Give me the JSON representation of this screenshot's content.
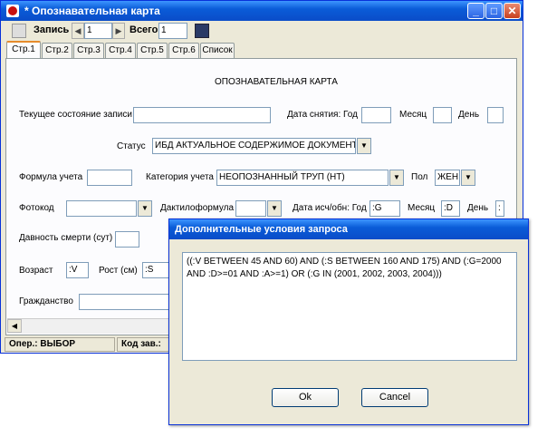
{
  "window": {
    "title": "* Опознавательная карта",
    "minimize_glyph": "_",
    "maximize_glyph": "□",
    "close_glyph": "✕"
  },
  "toolbar": {
    "record_label": "Запись",
    "record_value": "1",
    "total_label": "Всего",
    "total_value": "1",
    "prev_glyph": "◀",
    "next_glyph": "▶"
  },
  "tabs": [
    "Стр.1",
    "Стр.2",
    "Стр.3",
    "Стр.4",
    "Стр.5",
    "Стр.6",
    "Список"
  ],
  "form": {
    "heading": "ОПОЗНАВАТЕЛЬНАЯ КАРТА",
    "record_state_label": "Текущее состояние записи",
    "record_state_value": "",
    "date_year_label": "Дата снятия: Год",
    "date_year_value": "",
    "month_label": "Месяц",
    "month_value": "",
    "day_label": "День",
    "day_value": "",
    "status_label": "Статус",
    "status_value": "ИБД АКТУАЛЬНОЕ СОДЕРЖИМОЕ ДОКУМЕНТА",
    "formula_label": "Формула учета",
    "formula_value": "",
    "category_label": "Категория учета",
    "category_value": "НЕОПОЗНАННЫЙ ТРУП (НТ)",
    "sex_label": "Пол",
    "sex_value": "ЖЕН",
    "photocode_label": "Фотокод",
    "photocode_value": "",
    "dactylo_label": "Дактилоформула",
    "dactylo_value": "",
    "date_found_label": "Дата исч/обн: Год",
    "date_found_value": ":G",
    "month2_label": "Месяц",
    "month2_value": ":D",
    "day2_label": "День",
    "day2_value": ":",
    "death_age_label": "Давность смерти (сут)",
    "death_age_value": "",
    "age_label": "Возраст",
    "age_value": ":V",
    "height_label": "Рост (см)",
    "height_value": ":S",
    "citizenship_label": "Гражданство",
    "citizenship_value": "",
    "dropdown_glyph": "▼",
    "scroll_left_glyph": "◀"
  },
  "statusbar": {
    "oper": "Опер.: ВЫБОР",
    "code": "Код зав.:"
  },
  "dialog": {
    "title": "Дополнительные условия запроса",
    "query_line1": "((:V BETWEEN 45 AND 60) AND (:S BETWEEN 160 AND 175) AND (:G=2000",
    "query_line2": "AND :D>=01 AND :A>=1) OR (:G IN (2001, 2002, 2003, 2004)))",
    "ok_label": "Ok",
    "cancel_label": "Cancel"
  }
}
